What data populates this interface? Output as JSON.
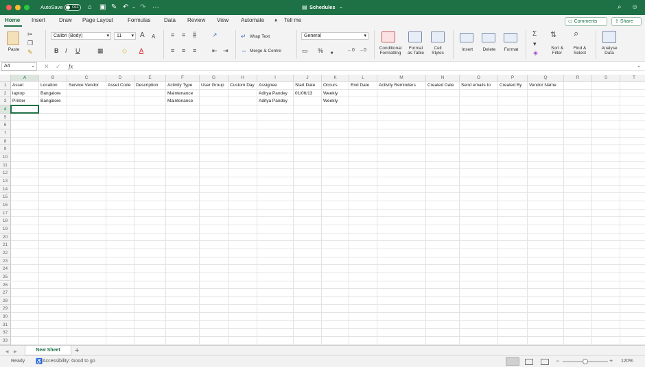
{
  "titlebar": {
    "autosave_label": "AutoSave",
    "autosave_state": "OFF",
    "doc_title": "Schedules",
    "title_chevron": "⌄",
    "home_icon": "⌂",
    "save_icon": "▣",
    "edit_icon": "✎",
    "undo_icon": "↶",
    "undo_dd": "⌄",
    "redo_icon": "↷",
    "more_icon": "···",
    "search_icon": "⌕",
    "user_icon": "☺"
  },
  "tabs": [
    "Home",
    "Insert",
    "Draw",
    "Page Layout",
    "Formulas",
    "Data",
    "Review",
    "View",
    "Automate"
  ],
  "tellme": {
    "icon": "♦",
    "label": "Tell me"
  },
  "comments": {
    "icon": "▭",
    "label": "Comments"
  },
  "share": {
    "icon": "⇪",
    "label": "Share"
  },
  "ribbon": {
    "paste": "Paste",
    "font_name": "Calibri (Body)",
    "font_size": "11",
    "font_grow": "A",
    "font_shrink": "A",
    "bold": "B",
    "italic": "I",
    "underline": "U",
    "borders": "▦",
    "fill": "◇",
    "font_color": "A",
    "align_top": "≡",
    "align_middle": "≡",
    "align_bottom": "≡",
    "align_left": "≡",
    "align_center": "≡",
    "align_right": "≡",
    "orientation": "↗",
    "indent_decrease": "⇤",
    "indent_increase": "⇥",
    "wrap_text": "Wrap Text",
    "merge_centre": "Merge & Centre",
    "number_format": "General",
    "currency": "▭",
    "percent": "%",
    "comma": "❟",
    "dec_increase": "←0",
    "dec_decrease": "→0",
    "conditional": [
      "Conditional",
      "Formatting"
    ],
    "format_table": [
      "Format",
      "as Table"
    ],
    "cell_styles": [
      "Cell",
      "Styles"
    ],
    "insert": "Insert",
    "delete": "Delete",
    "format": "Format",
    "autosum": "Σ",
    "fill_down": "▾",
    "clear": "◈",
    "sort_filter": [
      "Sort &",
      "Filter"
    ],
    "find_select": [
      "Find &",
      "Select"
    ],
    "analyse": [
      "Analyse",
      "Data"
    ]
  },
  "formula_bar": {
    "name_box": "A4",
    "cancel": "✕",
    "enter": "✓",
    "fx": "fx",
    "value": ""
  },
  "columns": [
    "A",
    "B",
    "C",
    "D",
    "E",
    "F",
    "G",
    "H",
    "I",
    "J",
    "K",
    "L",
    "M",
    "N",
    "O",
    "P",
    "Q",
    "R",
    "S",
    "T"
  ],
  "rows": [
    "1",
    "2",
    "3",
    "4",
    "5",
    "6",
    "7",
    "8",
    "9",
    "10",
    "11",
    "12",
    "13",
    "14",
    "15",
    "16",
    "17",
    "18",
    "19",
    "20",
    "21",
    "22",
    "23",
    "24",
    "25",
    "26",
    "27",
    "28",
    "29",
    "30",
    "31",
    "32",
    "33"
  ],
  "cells": [
    {
      "r": 0,
      "c": 0,
      "v": "Asset"
    },
    {
      "r": 0,
      "c": 1,
      "v": "Location"
    },
    {
      "r": 0,
      "c": 2,
      "v": "Service Vendor"
    },
    {
      "r": 0,
      "c": 3,
      "v": "Asset Code"
    },
    {
      "r": 0,
      "c": 4,
      "v": "Description"
    },
    {
      "r": 0,
      "c": 5,
      "v": "Activity Type"
    },
    {
      "r": 0,
      "c": 6,
      "v": "User Group"
    },
    {
      "r": 0,
      "c": 7,
      "v": "Custom Day"
    },
    {
      "r": 0,
      "c": 8,
      "v": "Assignee"
    },
    {
      "r": 0,
      "c": 9,
      "v": "Start Date"
    },
    {
      "r": 0,
      "c": 10,
      "v": "Occurs"
    },
    {
      "r": 0,
      "c": 11,
      "v": "End Date"
    },
    {
      "r": 0,
      "c": 12,
      "v": "Activity Reminders"
    },
    {
      "r": 0,
      "c": 13,
      "v": "Created Date"
    },
    {
      "r": 0,
      "c": 14,
      "v": "Send emails to"
    },
    {
      "r": 0,
      "c": 15,
      "v": "Created By"
    },
    {
      "r": 0,
      "c": 16,
      "v": "Vendor Name"
    },
    {
      "r": 1,
      "c": 0,
      "v": "laptop"
    },
    {
      "r": 1,
      "c": 1,
      "v": "Bangalore"
    },
    {
      "r": 1,
      "c": 5,
      "v": "Maintenance"
    },
    {
      "r": 1,
      "c": 8,
      "v": "Aditya Pandey"
    },
    {
      "r": 1,
      "c": 9,
      "v": "01/06/13"
    },
    {
      "r": 1,
      "c": 10,
      "v": "Weekly"
    },
    {
      "r": 2,
      "c": 0,
      "v": "Printer"
    },
    {
      "r": 2,
      "c": 1,
      "v": "Bangalore"
    },
    {
      "r": 2,
      "c": 5,
      "v": "Maintenance"
    },
    {
      "r": 2,
      "c": 8,
      "v": "Aditya Pandey"
    },
    {
      "r": 2,
      "c": 10,
      "v": "Weekly"
    }
  ],
  "selected_cell": {
    "r": 3,
    "c": 0
  },
  "sheet_tabs": {
    "active": "New Sheet",
    "prev": "◂",
    "next": "▸",
    "add": "+"
  },
  "status": {
    "ready": "Ready",
    "accessibility": "Accessibility: Good to go",
    "zoom": "120%",
    "zoom_minus": "−",
    "zoom_plus": "+"
  },
  "colors": {
    "brand_green": "#1e7145",
    "titlebar": "#1e7145"
  }
}
